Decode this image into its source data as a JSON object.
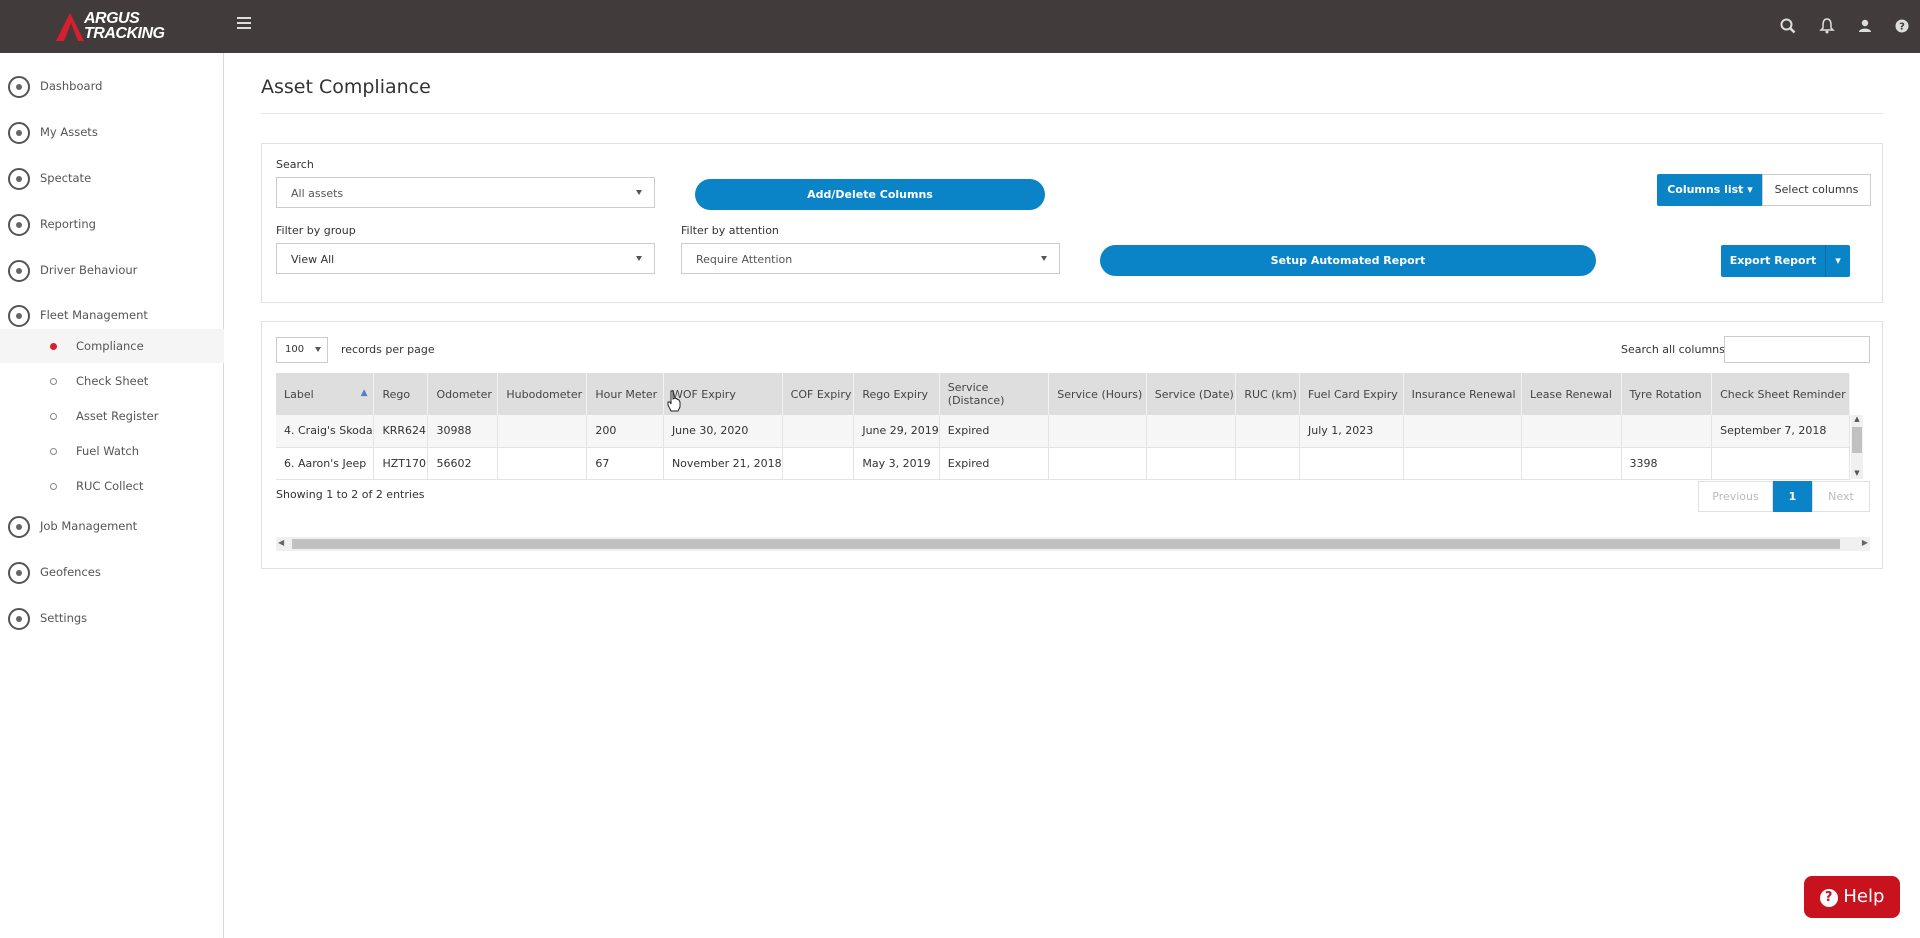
{
  "header": {
    "logo_line1": "ARGUS",
    "logo_line2": "TRACKING"
  },
  "sidebar": {
    "items": [
      {
        "label": "Dashboard",
        "icon": "speedometer-icon"
      },
      {
        "label": "My Assets",
        "icon": "assets-icon"
      },
      {
        "label": "Spectate",
        "icon": "map-pin-icon"
      },
      {
        "label": "Reporting",
        "icon": "report-icon"
      },
      {
        "label": "Driver Behaviour",
        "icon": "driver-icon"
      },
      {
        "label": "Fleet Management",
        "icon": "fleet-icon"
      }
    ],
    "fleet_sub": [
      "Compliance",
      "Check Sheet",
      "Asset Register",
      "Fuel Watch",
      "RUC Collect"
    ],
    "items_after": [
      {
        "label": "Job Management",
        "icon": "briefcase-icon"
      },
      {
        "label": "Geofences",
        "icon": "geofence-icon"
      },
      {
        "label": "Settings",
        "icon": "gear-icon"
      }
    ]
  },
  "page": {
    "title": "Asset Compliance"
  },
  "filters": {
    "search_label": "Search",
    "search_value": "All assets",
    "add_delete_columns": "Add/Delete Columns",
    "columns_list": "Columns list",
    "select_columns": "Select columns",
    "group_label": "Filter by group",
    "group_value": "View All",
    "attention_label": "Filter by attention",
    "attention_value": "Require Attention",
    "setup_report": "Setup Automated Report",
    "export_report": "Export Report"
  },
  "table": {
    "page_size": "100",
    "records_per_page": "records per page",
    "search_all_label": "Search all columns:",
    "columns": [
      "Label",
      "Rego",
      "Odometer",
      "Hubodometer",
      "Hour Meter",
      "WOF Expiry",
      "COF Expiry",
      "Rego Expiry",
      "Service (Distance)",
      "Service (Hours)",
      "Service (Date)",
      "RUC (km)",
      "Fuel Card Expiry",
      "Insurance Renewal",
      "Lease Renewal",
      "Tyre Rotation",
      "Check Sheet Reminder"
    ],
    "rows": [
      [
        "4. Craig's Skoda",
        "KRR624",
        "30988",
        "",
        "200",
        "June 30, 2020",
        "",
        "June 29, 2019",
        "Expired",
        "",
        "",
        "",
        "July 1, 2023",
        "",
        "",
        "",
        "September 7, 2018"
      ],
      [
        "6. Aaron's Jeep",
        "HZT170",
        "56602",
        "",
        "67",
        "November 21, 2018",
        "",
        "May 3, 2019",
        "Expired",
        "",
        "",
        "",
        "",
        "",
        "",
        "3398",
        ""
      ]
    ],
    "showing": "Showing 1 to 2 of 2 entries",
    "prev": "Previous",
    "page": "1",
    "next": "Next"
  },
  "help": {
    "label": "Help"
  }
}
